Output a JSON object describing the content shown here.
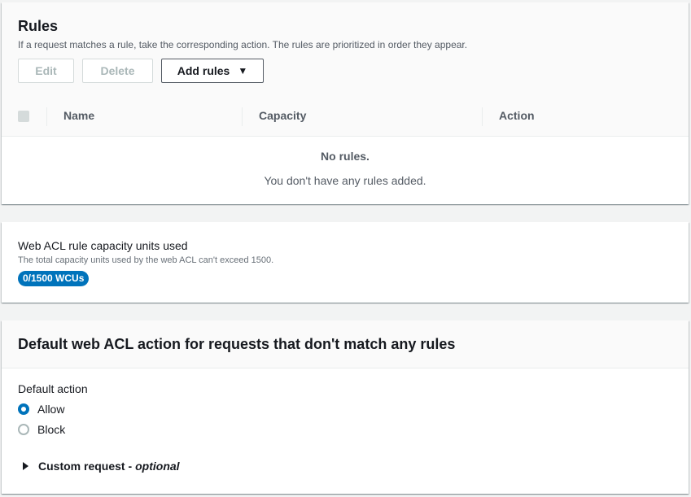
{
  "rules": {
    "title": "Rules",
    "description": "If a request matches a rule, take the corresponding action. The rules are prioritized in order they appear.",
    "edit_label": "Edit",
    "delete_label": "Delete",
    "add_label": "Add rules",
    "columns": [
      "Name",
      "Capacity",
      "Action"
    ],
    "empty_title": "No rules.",
    "empty_description": "You don't have any rules added."
  },
  "wcu": {
    "title": "Web ACL rule capacity units used",
    "description": "The total capacity units used by the web ACL can't exceed 1500.",
    "badge": "0/1500 WCUs"
  },
  "default_action": {
    "title": "Default web ACL action for requests that don't match any rules",
    "field_label": "Default action",
    "options": [
      {
        "label": "Allow",
        "selected": true
      },
      {
        "label": "Block",
        "selected": false
      }
    ],
    "custom_request_label": "Custom request -",
    "custom_request_optional": "optional"
  },
  "colors": {
    "accent": "#0073bb",
    "disabled": "#aab7b8"
  }
}
